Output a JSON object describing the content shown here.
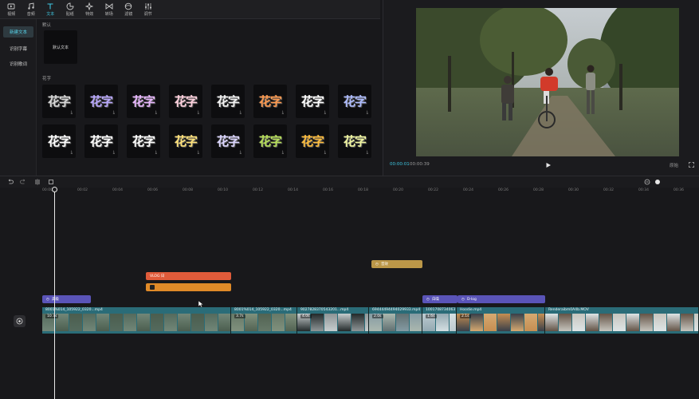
{
  "toolbar": {
    "items": [
      {
        "label": "视频",
        "icon": "video-icon"
      },
      {
        "label": "音频",
        "icon": "audio-icon"
      },
      {
        "label": "文本",
        "icon": "text-icon",
        "active": true
      },
      {
        "label": "贴纸",
        "icon": "sticker-icon"
      },
      {
        "label": "特效",
        "icon": "effects-icon"
      },
      {
        "label": "转场",
        "icon": "transition-icon"
      },
      {
        "label": "滤镜",
        "icon": "filter-icon"
      },
      {
        "label": "调节",
        "icon": "adjust-icon"
      }
    ]
  },
  "sidebar": {
    "items": [
      {
        "label": "新建文本",
        "active": true
      },
      {
        "label": "识别字幕"
      },
      {
        "label": "识别歌词"
      }
    ]
  },
  "panel": {
    "default_section": "默认",
    "default_tile": "默认文本",
    "fancy_section": "花字",
    "fancy_text": "花字",
    "download_icon": "download-icon",
    "fancy_colors": [
      "#d8d8d8",
      "#b9a8ff",
      "#e9b8ff",
      "#ffd1de",
      "#f4f4f4",
      "#ff9b50",
      "#ffffff",
      "#aebcff",
      "#ffffff",
      "#ffffff",
      "#ffffff",
      "#ffe27a",
      "#dcd6ff",
      "#b8e05a",
      "#ffbd3c",
      "#f0f5a0"
    ]
  },
  "player": {
    "current_time": "00:00:01",
    "total_time": "00:00:39",
    "ratio_label": "原始",
    "play_icon": "play-icon",
    "fullscreen_icon": "fullscreen-icon"
  },
  "timeline": {
    "ticks": [
      "00:00",
      "00:02",
      "00:04",
      "00:06",
      "00:08",
      "00:10",
      "00:12",
      "00:14",
      "00:16",
      "00:18",
      "00:20",
      "00:22",
      "00:24",
      "00:26",
      "00:28",
      "00:30",
      "00:32",
      "00:34",
      "00:36",
      "00:38"
    ],
    "clips": {
      "audio_tag": "音效",
      "text_clip": "VLOG 日",
      "filter_1": "高级",
      "filter_2": "白噪",
      "filter_3": "D-log"
    },
    "segments": [
      {
        "name": "8001%014_105922_0320...mp4",
        "duration": "10.7s"
      },
      {
        "name": "8001%014_105922_0320...mp4",
        "duration": "3.7s"
      },
      {
        "name": "9027828370543201...mp4",
        "duration": "4.0s"
      },
      {
        "name": "69444494494029933.mp4",
        "duration": "2.0s"
      },
      {
        "name": "1001708734063",
        "duration": "1.6s"
      },
      {
        "name": "Hoodie.mp4",
        "duration": "2.1s"
      },
      {
        "name": "Renderaibm0A4b.MOV",
        "duration": ""
      }
    ]
  },
  "colors": {
    "accent": "#3ec6e0",
    "text_clip": "#e05b3a",
    "text_clip_2": "#e08a28",
    "audio_clip": "#bb9748",
    "filter_clip": "#5a54b8",
    "main_track": "#2a6c78"
  }
}
